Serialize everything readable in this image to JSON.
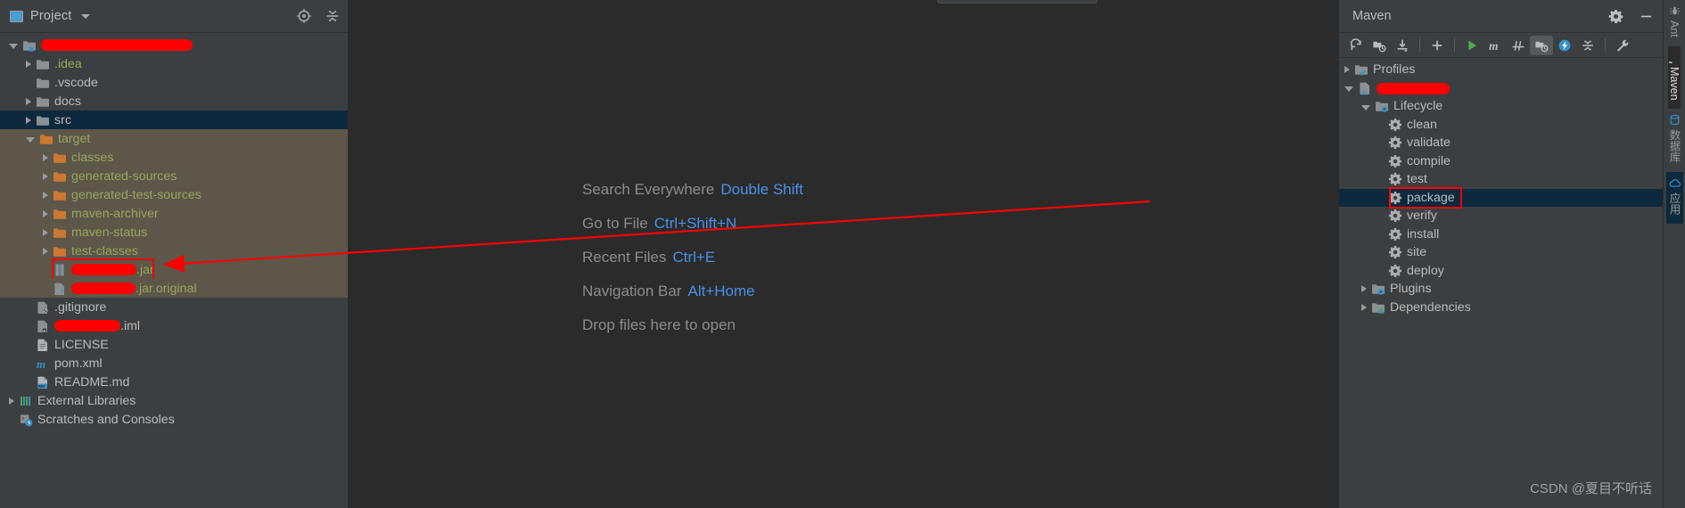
{
  "project_panel": {
    "title": "Project",
    "icons": [
      "project-view-icon",
      "chevron-down-icon",
      "locate-target-icon",
      "collapse-all-icon"
    ],
    "tree": [
      {
        "label": "",
        "redacted": true,
        "redact_width": 170,
        "indent": 0,
        "arrow": "open",
        "icon": "module-folder-icon",
        "color": "white"
      },
      {
        "label": ".idea",
        "indent": 1,
        "arrow": "closed",
        "icon": "folder-grey-icon",
        "color": "green"
      },
      {
        "label": ".vscode",
        "indent": 1,
        "arrow": "none",
        "icon": "folder-grey-icon",
        "color": "white"
      },
      {
        "label": "docs",
        "indent": 1,
        "arrow": "closed",
        "icon": "folder-grey-icon",
        "color": "white"
      },
      {
        "label": "src",
        "indent": 1,
        "arrow": "closed",
        "icon": "folder-grey-icon",
        "color": "white",
        "selected": true
      },
      {
        "label": "target",
        "indent": 1,
        "arrow": "open",
        "icon": "folder-orange-icon",
        "color": "green",
        "excluded": true
      },
      {
        "label": "classes",
        "indent": 2,
        "arrow": "closed",
        "icon": "folder-orange-icon",
        "color": "green",
        "excluded": true
      },
      {
        "label": "generated-sources",
        "indent": 2,
        "arrow": "closed",
        "icon": "folder-orange-icon",
        "color": "green",
        "excluded": true
      },
      {
        "label": "generated-test-sources",
        "indent": 2,
        "arrow": "closed",
        "icon": "folder-orange-icon",
        "color": "green",
        "excluded": true
      },
      {
        "label": "maven-archiver",
        "indent": 2,
        "arrow": "closed",
        "icon": "folder-orange-icon",
        "color": "green",
        "excluded": true
      },
      {
        "label": "maven-status",
        "indent": 2,
        "arrow": "closed",
        "icon": "folder-orange-icon",
        "color": "green",
        "excluded": true
      },
      {
        "label": "test-classes",
        "indent": 2,
        "arrow": "closed",
        "icon": "folder-orange-icon",
        "color": "green",
        "excluded": true
      },
      {
        "label": ".jar",
        "redacted": true,
        "redact_width": 73,
        "indent": 2,
        "arrow": "none",
        "icon": "jar-archive-icon",
        "color": "green",
        "excluded": true,
        "highlight_box": true
      },
      {
        "label": ".jar.original",
        "redacted": true,
        "redact_width": 72,
        "indent": 2,
        "arrow": "none",
        "icon": "unknown-file-icon",
        "color": "green",
        "excluded": true
      },
      {
        "label": ".gitignore",
        "indent": 1,
        "arrow": "none",
        "icon": "gitignore-file-icon",
        "color": "white"
      },
      {
        "label": ".iml",
        "redacted": true,
        "redact_width": 74,
        "indent": 1,
        "arrow": "none",
        "icon": "iml-file-icon",
        "color": "white"
      },
      {
        "label": "LICENSE",
        "indent": 1,
        "arrow": "none",
        "icon": "text-file-icon",
        "color": "white"
      },
      {
        "label": "pom.xml",
        "indent": 1,
        "arrow": "none",
        "icon": "maven-pom-icon",
        "color": "white"
      },
      {
        "label": "README.md",
        "indent": 1,
        "arrow": "none",
        "icon": "markdown-file-icon",
        "color": "white"
      },
      {
        "label": "External Libraries",
        "indent": 0,
        "arrow": "closed",
        "icon": "libraries-icon",
        "color": "white"
      },
      {
        "label": "Scratches and Consoles",
        "indent": 0,
        "arrow": "none",
        "icon": "scratches-icon",
        "color": "white"
      }
    ]
  },
  "editor": {
    "tips": [
      {
        "action": "Search Everywhere",
        "shortcut": "Double Shift"
      },
      {
        "action": "Go to File",
        "shortcut": "Ctrl+Shift+N"
      },
      {
        "action": "Recent Files",
        "shortcut": "Ctrl+E"
      },
      {
        "action": "Navigation Bar",
        "shortcut": "Alt+Home"
      },
      {
        "action": "Drop files here to open",
        "shortcut": ""
      }
    ]
  },
  "maven_panel": {
    "title": "Maven",
    "header_icons": [
      "gear-icon",
      "minimize-icon"
    ],
    "toolbar": [
      {
        "name": "reload-all-projects-icon",
        "active": false
      },
      {
        "name": "add-maven-project-icon",
        "active": false
      },
      {
        "name": "download-sources-icon",
        "active": false
      },
      {
        "name": "separator",
        "active": false
      },
      {
        "name": "add-icon",
        "active": false
      },
      {
        "name": "separator",
        "active": false
      },
      {
        "name": "run-icon",
        "active": false
      },
      {
        "name": "execute-maven-goal-icon",
        "active": false
      },
      {
        "name": "toggle-skip-tests-icon",
        "active": false
      },
      {
        "name": "show-history-icon",
        "active": true
      },
      {
        "name": "offline-mode-icon",
        "active": false
      },
      {
        "name": "collapse-all-icon",
        "active": false
      },
      {
        "name": "separator",
        "active": false
      },
      {
        "name": "maven-settings-icon",
        "active": false
      }
    ],
    "tree": [
      {
        "label": "Profiles",
        "indent": 0,
        "arrow": "closed",
        "icon": "profiles-folder-icon"
      },
      {
        "label": "",
        "redacted": true,
        "redact_width": 82,
        "indent": 0,
        "arrow": "open",
        "icon": "maven-project-icon"
      },
      {
        "label": "Lifecycle",
        "indent": 1,
        "arrow": "open",
        "icon": "lifecycle-folder-icon"
      },
      {
        "label": "clean",
        "indent": 2,
        "arrow": "none",
        "icon": "maven-goal-icon"
      },
      {
        "label": "validate",
        "indent": 2,
        "arrow": "none",
        "icon": "maven-goal-icon"
      },
      {
        "label": "compile",
        "indent": 2,
        "arrow": "none",
        "icon": "maven-goal-icon"
      },
      {
        "label": "test",
        "indent": 2,
        "arrow": "none",
        "icon": "maven-goal-icon"
      },
      {
        "label": "package",
        "indent": 2,
        "arrow": "none",
        "icon": "maven-goal-icon",
        "selected": true,
        "highlight_box": true
      },
      {
        "label": "verify",
        "indent": 2,
        "arrow": "none",
        "icon": "maven-goal-icon"
      },
      {
        "label": "install",
        "indent": 2,
        "arrow": "none",
        "icon": "maven-goal-icon"
      },
      {
        "label": "site",
        "indent": 2,
        "arrow": "none",
        "icon": "maven-goal-icon"
      },
      {
        "label": "deploy",
        "indent": 2,
        "arrow": "none",
        "icon": "maven-goal-icon"
      },
      {
        "label": "Plugins",
        "indent": 1,
        "arrow": "closed",
        "icon": "plugins-folder-icon"
      },
      {
        "label": "Dependencies",
        "indent": 1,
        "arrow": "closed",
        "icon": "dependencies-folder-icon"
      }
    ]
  },
  "right_strip": [
    {
      "label": "Ant",
      "icon": "ant-icon",
      "active": false
    },
    {
      "label": "Maven",
      "icon": "maven-m-icon",
      "active": true
    },
    {
      "label": "数据库",
      "icon": "database-icon",
      "active": false
    },
    {
      "label": "应用",
      "icon": "cloud-icon",
      "active": false,
      "selected": true
    }
  ],
  "watermark": "CSDN @夏目不听话",
  "colors": {
    "panel_bg": "#3c3f41",
    "editor_bg": "#2b2b2b",
    "selection_blue": "#0d293e",
    "excluded_bg": "#5c5749",
    "annotation_red": "#fe0000",
    "shortcut_blue": "#4992e8",
    "text_grey": "#bbbbbb",
    "green_text": "#9aa55c",
    "orange_folder": "#cc7832"
  }
}
